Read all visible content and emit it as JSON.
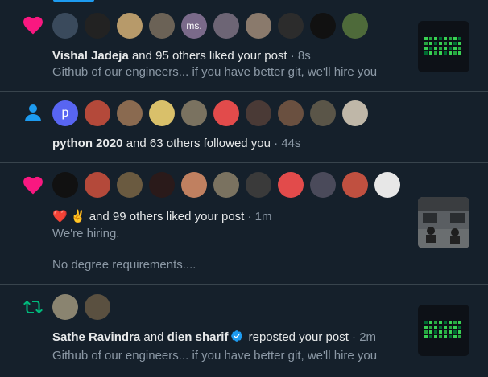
{
  "notifications": [
    {
      "type": "like",
      "icon": "heart-icon",
      "avatars": [
        "",
        "",
        "",
        "",
        "ms.",
        "",
        "",
        "",
        "",
        ""
      ],
      "actor": "Vishal Jadeja",
      "rest": "and 95 others liked your post",
      "time": "· 8s",
      "text": "Github of our engineers... if you have better git, we'll hire you",
      "has_thumbnail": true
    },
    {
      "type": "follow",
      "icon": "person-icon",
      "avatars": [
        "p",
        "",
        "",
        "",
        "",
        "",
        "",
        "",
        "",
        ""
      ],
      "actor": "python 2020",
      "rest": "and 63 others followed you",
      "time": "· 44s"
    },
    {
      "type": "like",
      "icon": "heart-icon",
      "avatars": [
        "",
        "",
        "",
        "",
        "",
        "",
        "",
        "",
        "",
        "",
        ""
      ],
      "actor_emoji": "❤️ ✌️",
      "rest": "and 99 others liked your post",
      "time": "· 1m",
      "text_line1": "We're hiring.",
      "text_line2": "No degree requirements....",
      "has_thumbnail": true
    },
    {
      "type": "repost",
      "icon": "repost-icon",
      "avatars": [
        "",
        ""
      ],
      "actor": "Sathe Ravindra",
      "and_word": "and",
      "actor2": "dien sharif",
      "rest": "reposted your post",
      "time": "· 2m",
      "text": "Github of our engineers... if you have better git, we'll hire you",
      "has_thumbnail": true
    }
  ],
  "colors": {
    "background": "#15202b",
    "heart": "#f91880",
    "follow": "#1d9bf0",
    "repost": "#00ba7c",
    "muted": "#8b98a5",
    "divider": "#38444d"
  }
}
